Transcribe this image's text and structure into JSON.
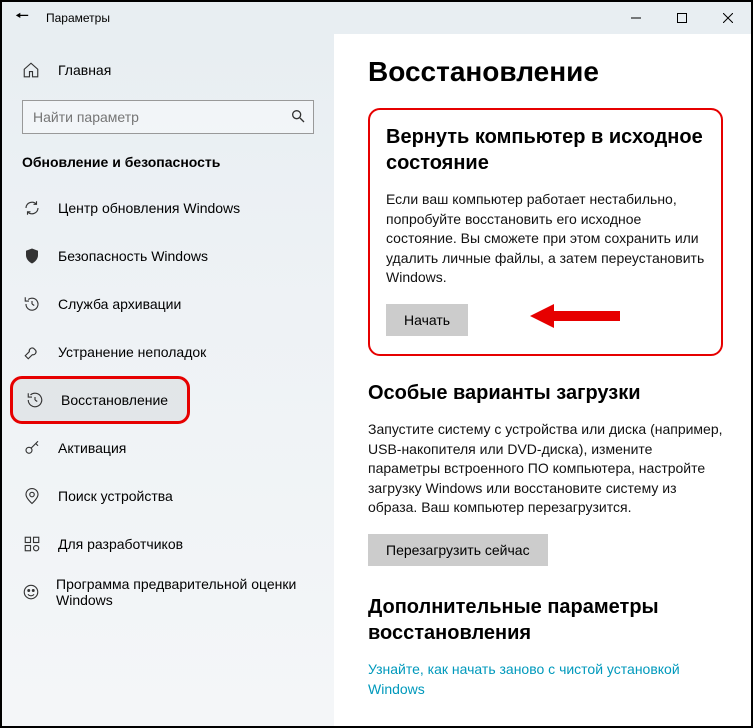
{
  "window": {
    "title": "Параметры"
  },
  "sidebar": {
    "home_label": "Главная",
    "search_placeholder": "Найти параметр",
    "group_title": "Обновление и безопасность",
    "items": [
      {
        "label": "Центр обновления Windows"
      },
      {
        "label": "Безопасность Windows"
      },
      {
        "label": "Служба архивации"
      },
      {
        "label": "Устранение неполадок"
      },
      {
        "label": "Восстановление"
      },
      {
        "label": "Активация"
      },
      {
        "label": "Поиск устройства"
      },
      {
        "label": "Для разработчиков"
      },
      {
        "label": "Программа предварительной оценки Windows"
      }
    ]
  },
  "main": {
    "page_title": "Восстановление",
    "reset": {
      "heading": "Вернуть компьютер в исходное состояние",
      "desc": "Если ваш компьютер работает нестабильно, попробуйте восстановить его исходное состояние. Вы сможете при этом сохранить или удалить личные файлы, а затем переустановить Windows.",
      "button": "Начать"
    },
    "advanced": {
      "heading": "Особые варианты загрузки",
      "desc": "Запустите систему с устройства или диска (например, USB-накопителя или DVD-диска), измените параметры встроенного ПО компьютера, настройте загрузку Windows или восстановите систему из образа. Ваш компьютер перезагрузится.",
      "button": "Перезагрузить сейчас"
    },
    "more": {
      "heading": "Дополнительные параметры восстановления",
      "link": "Узнайте, как начать заново с чистой установкой Windows"
    }
  }
}
